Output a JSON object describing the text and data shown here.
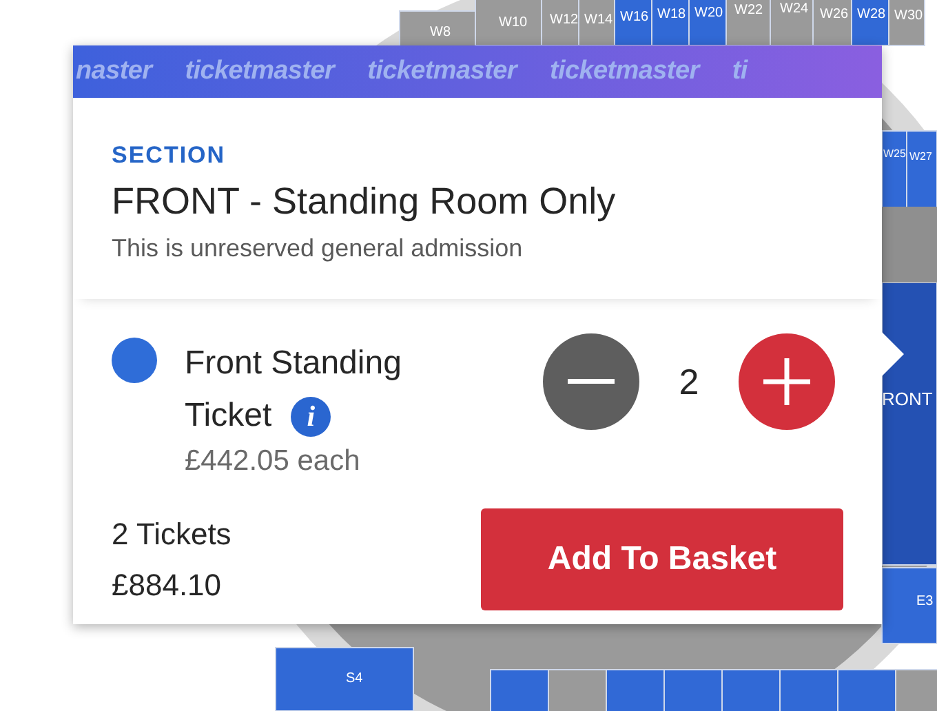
{
  "seat_map": {
    "sections": [
      {
        "label": "W8",
        "available": false
      },
      {
        "label": "W10",
        "available": false
      },
      {
        "label": "W12",
        "available": false
      },
      {
        "label": "W14",
        "available": false
      },
      {
        "label": "W16",
        "available": true
      },
      {
        "label": "W18",
        "available": true
      },
      {
        "label": "W20",
        "available": true
      },
      {
        "label": "W22",
        "available": false
      },
      {
        "label": "W24",
        "available": false
      },
      {
        "label": "W26",
        "available": false
      },
      {
        "label": "W28",
        "available": true
      },
      {
        "label": "W30",
        "available": false
      },
      {
        "label": "W25",
        "available": true
      },
      {
        "label": "W27",
        "available": true
      },
      {
        "label": "RONT",
        "available": true
      },
      {
        "label": "E3",
        "available": true
      },
      {
        "label": "S4",
        "available": true
      }
    ]
  },
  "card": {
    "banner": [
      "naster",
      "ticketmaster",
      "ticketmaster",
      "ticketmaster",
      "ti"
    ],
    "section_heading": "SECTION",
    "section_name": "FRONT - Standing Room Only",
    "section_note": "This is unreserved general admission",
    "ticket": {
      "name_lines": [
        "Front Standing",
        "Ticket"
      ],
      "color": "#2f6dd8",
      "info": "i",
      "price": "£442.05 each",
      "quantity": "2"
    },
    "total_count": "2 Tickets",
    "total_price": "£884.10",
    "button": "Add To Basket"
  }
}
